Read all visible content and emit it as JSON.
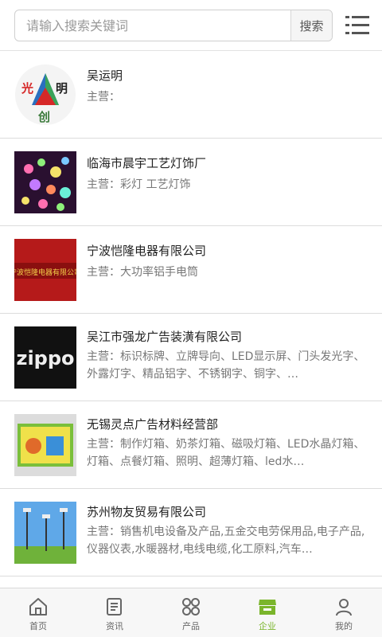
{
  "search": {
    "placeholder": "请输入搜索关键词",
    "button": "搜索"
  },
  "companies": [
    {
      "name": "吴运明",
      "main": "主营：",
      "logo_text": [
        "光",
        "明",
        "创"
      ]
    },
    {
      "name": "临海市晨宇工艺灯饰厂",
      "main": "主营：彩灯 工艺灯饰"
    },
    {
      "name": "宁波恺隆电器有限公司",
      "main": "主营：大功率铝手电筒",
      "logo_text": "宁波恺隆电器有限公司"
    },
    {
      "name": "吴江市强龙广告装潢有限公司",
      "main": "主营：标识标牌、立牌导向、LED显示屏、门头发光字、外露灯字、精品铝字、不锈钢字、铜字、…",
      "logo_text": "zippo"
    },
    {
      "name": "无锡灵点广告材料经营部",
      "main": "主营：制作灯箱、奶茶灯箱、磁吸灯箱、LED水晶灯箱、灯箱、点餐灯箱、照明、超薄灯箱、led水…"
    },
    {
      "name": "苏州物友贸易有限公司",
      "main": "主营：销售机电设备及产品,五金交电劳保用品,电子产品,仪器仪表,水暖器材,电线电缆,化工原料,汽车…"
    }
  ],
  "tabs": [
    {
      "label": "首页",
      "icon": "home-icon"
    },
    {
      "label": "资讯",
      "icon": "news-icon"
    },
    {
      "label": "产品",
      "icon": "grid-icon"
    },
    {
      "label": "企业",
      "icon": "store-icon",
      "active": true
    },
    {
      "label": "我的",
      "icon": "user-icon"
    }
  ],
  "colors": {
    "accent": "#7ab52b",
    "divider": "#dcdcdc",
    "tab_bg": "#f7f7f7"
  }
}
